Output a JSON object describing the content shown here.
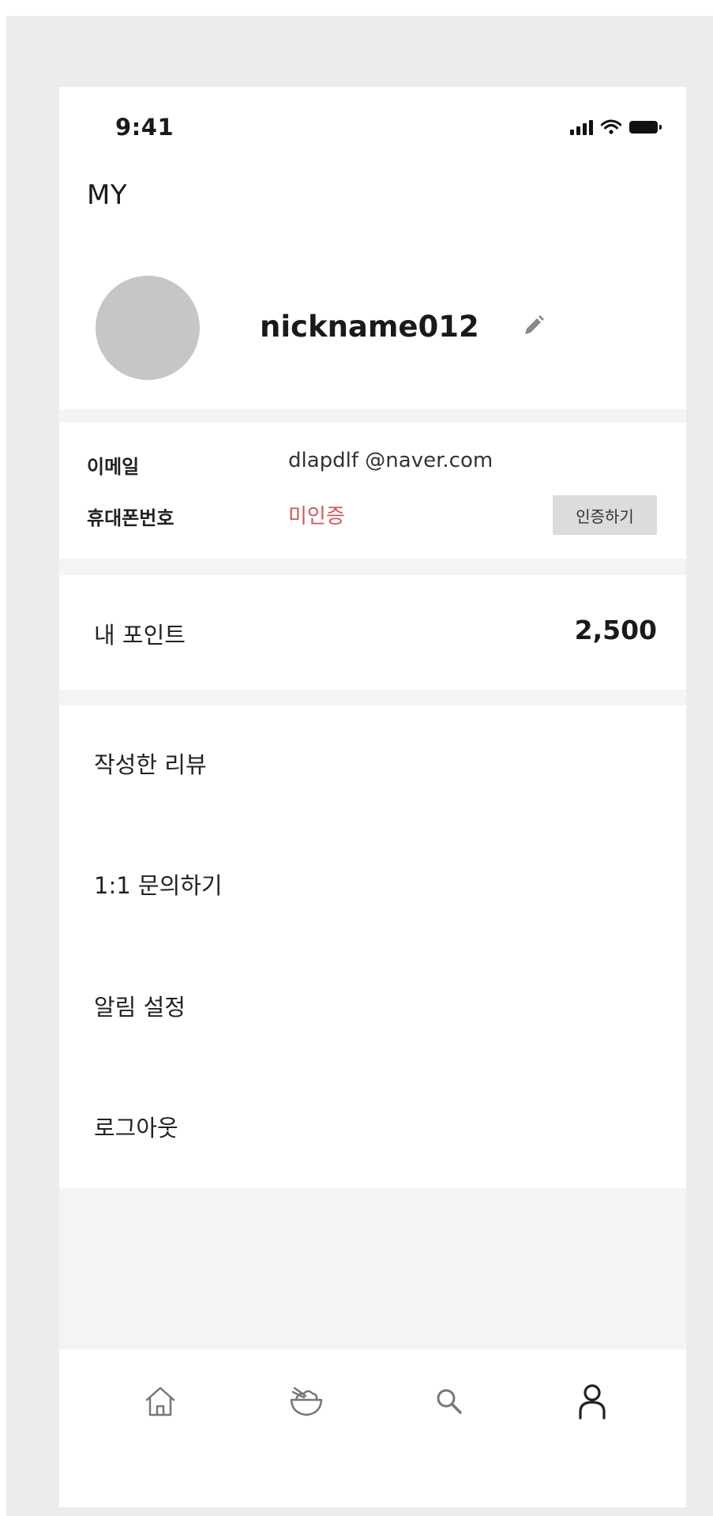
{
  "status_bar": {
    "time": "9:41"
  },
  "header": {
    "title": "MY"
  },
  "profile": {
    "nickname": "nickname012"
  },
  "account": {
    "email_label": "이메일",
    "email_value": "dlapdlf @naver.com",
    "phone_label": "휴대폰번호",
    "phone_status": "미인증",
    "verify_button": "인증하기",
    "phone_status_color": "#cf5a5a"
  },
  "points": {
    "label": "내 포인트",
    "value": "2,500"
  },
  "menu": {
    "items": [
      {
        "label": "작성한 리뷰"
      },
      {
        "label": "1:1 문의하기"
      },
      {
        "label": "알림 설정"
      },
      {
        "label": "로그아웃"
      }
    ]
  },
  "bottom_nav": {
    "items": [
      {
        "icon": "home-icon",
        "active": false
      },
      {
        "icon": "bowl-icon",
        "active": false
      },
      {
        "icon": "search-icon",
        "active": false
      },
      {
        "icon": "user-icon",
        "active": true
      }
    ]
  }
}
